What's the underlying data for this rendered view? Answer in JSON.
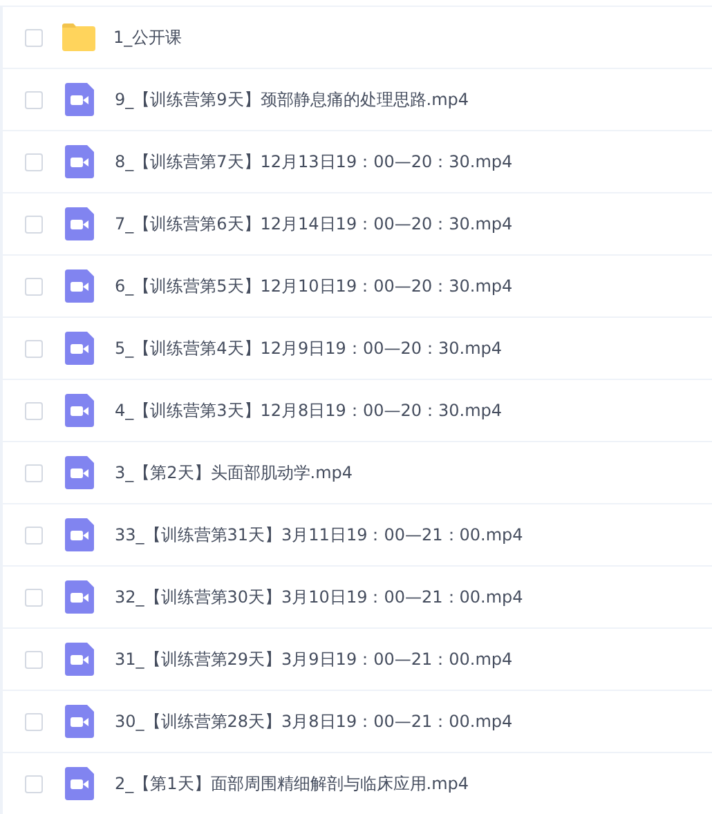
{
  "files": [
    {
      "kind": "folder",
      "name": "1_公开课",
      "checked": false
    },
    {
      "kind": "video",
      "name": "9_【训练营第9天】颈部静息痛的处理思路.mp4",
      "checked": false
    },
    {
      "kind": "video",
      "name": "8_【训练营第7天】12月13日19：00—20：30.mp4",
      "checked": false
    },
    {
      "kind": "video",
      "name": "7_【训练营第6天】12月14日19：00—20：30.mp4",
      "checked": false
    },
    {
      "kind": "video",
      "name": "6_【训练营第5天】12月10日19：00—20：30.mp4",
      "checked": false
    },
    {
      "kind": "video",
      "name": "5_【训练营第4天】12月9日19：00—20：30.mp4",
      "checked": false
    },
    {
      "kind": "video",
      "name": "4_【训练营第3天】12月8日19：00—20：30.mp4",
      "checked": false
    },
    {
      "kind": "video",
      "name": "3_【第2天】头面部肌动学.mp4",
      "checked": false
    },
    {
      "kind": "video",
      "name": "33_【训练营第31天】3月11日19：00—21：00.mp4",
      "checked": false
    },
    {
      "kind": "video",
      "name": "32_【训练营第30天】3月10日19：00—21：00.mp4",
      "checked": false
    },
    {
      "kind": "video",
      "name": "31_【训练营第29天】3月9日19：00—21：00.mp4",
      "checked": false
    },
    {
      "kind": "video",
      "name": "30_【训练营第28天】3月8日19：00—21：00.mp4",
      "checked": false
    },
    {
      "kind": "video",
      "name": "2_【第1天】面部周围精细解剖与临床应用.mp4",
      "checked": false
    }
  ]
}
